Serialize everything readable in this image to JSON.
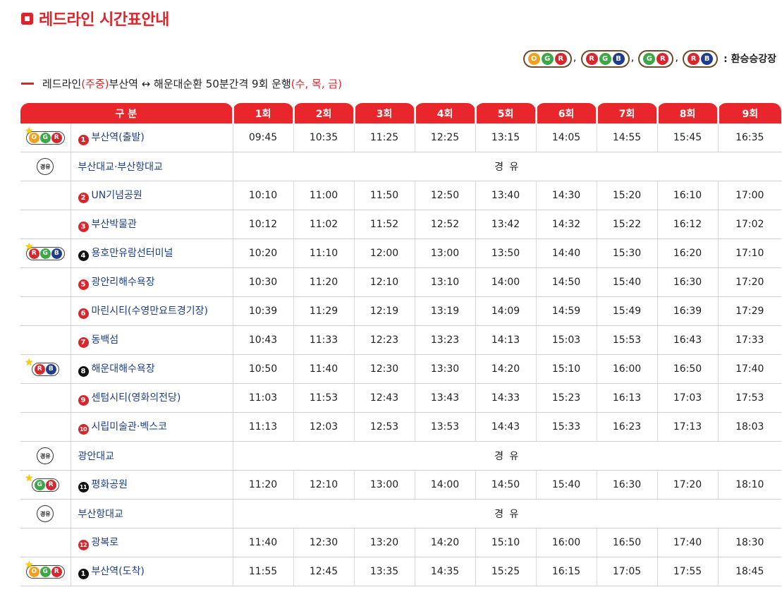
{
  "page": {
    "title": "레드라인 시간표안내"
  },
  "legend": {
    "badges": [
      [
        "O",
        "G",
        "R"
      ],
      [
        "R",
        "G",
        "B"
      ],
      [
        "G",
        "R"
      ],
      [
        "R",
        "B"
      ]
    ],
    "separator": ",",
    "description": ": 환승승강장"
  },
  "subtitle": {
    "prefix": "레드라인",
    "days_note": "(주중)",
    "route": " 부산역 ↔ 해운대순환 50분간격 9회 운행",
    "days": "(수, 목, 금)"
  },
  "table": {
    "header": {
      "section": "구 분",
      "runs": [
        "1회",
        "2회",
        "3회",
        "4회",
        "5회",
        "6회",
        "7회",
        "8회",
        "9회"
      ]
    },
    "via_label": "경 유",
    "via_icon_text": "경유",
    "rows": [
      {
        "mark": "badge",
        "lines": [
          "O",
          "G",
          "R"
        ],
        "num": "1",
        "num_style": "red",
        "name": "부산역(출발)",
        "times": [
          "09:45",
          "10:35",
          "11:25",
          "12:25",
          "13:15",
          "14:05",
          "14:55",
          "15:45",
          "16:35"
        ]
      },
      {
        "mark": "via",
        "name": "부산대교·부산항대교"
      },
      {
        "mark": "",
        "num": "2",
        "num_style": "red",
        "name": "UN기념공원",
        "times": [
          "10:10",
          "11:00",
          "11:50",
          "12:50",
          "13:40",
          "14:30",
          "15:20",
          "16:10",
          "17:00"
        ]
      },
      {
        "mark": "",
        "num": "3",
        "num_style": "red",
        "name": "부산박물관",
        "times": [
          "10:12",
          "11:02",
          "11:52",
          "12:52",
          "13:42",
          "14:32",
          "15:22",
          "16:12",
          "17:02"
        ]
      },
      {
        "mark": "badge",
        "lines": [
          "R",
          "G",
          "B"
        ],
        "num": "4",
        "num_style": "black",
        "name": "용호만유람선터미널",
        "times": [
          "10:20",
          "11:10",
          "12:00",
          "13:00",
          "13:50",
          "14:40",
          "15:30",
          "16:20",
          "17:10"
        ]
      },
      {
        "mark": "",
        "num": "5",
        "num_style": "red",
        "name": "광안리해수욕장",
        "times": [
          "10:30",
          "11:20",
          "12:10",
          "13:10",
          "14:00",
          "14:50",
          "15:40",
          "16:30",
          "17:20"
        ]
      },
      {
        "mark": "",
        "num": "6",
        "num_style": "red",
        "name": "마린시티(수영만요트경기장)",
        "times": [
          "10:39",
          "11:29",
          "12:19",
          "13:19",
          "14:09",
          "14:59",
          "15:49",
          "16:39",
          "17:29"
        ]
      },
      {
        "mark": "",
        "num": "7",
        "num_style": "red",
        "name": "동백섬",
        "times": [
          "10:43",
          "11:33",
          "12:23",
          "13:23",
          "14:13",
          "15:03",
          "15:53",
          "16:43",
          "17:33"
        ]
      },
      {
        "mark": "badge",
        "lines": [
          "R",
          "B"
        ],
        "num": "8",
        "num_style": "black",
        "name": "해운대해수욕장",
        "times": [
          "10:50",
          "11:40",
          "12:30",
          "13:30",
          "14:20",
          "15:10",
          "16:00",
          "16:50",
          "17:40"
        ]
      },
      {
        "mark": "",
        "num": "9",
        "num_style": "red",
        "name": "센텀시티(영화의전당)",
        "times": [
          "11:03",
          "11:53",
          "12:43",
          "13:43",
          "14:33",
          "15:23",
          "16:13",
          "17:03",
          "17:53"
        ]
      },
      {
        "mark": "",
        "num": "10",
        "num_style": "red",
        "name": "시립미술관·벡스코",
        "times": [
          "11:13",
          "12:03",
          "12:53",
          "13:53",
          "14:43",
          "15:33",
          "16:23",
          "17:13",
          "18:03"
        ]
      },
      {
        "mark": "via",
        "name": "광안대교"
      },
      {
        "mark": "badge",
        "lines": [
          "G",
          "R"
        ],
        "num": "11",
        "num_style": "black",
        "name": "평화공원",
        "times": [
          "11:20",
          "12:10",
          "13:00",
          "14:00",
          "14:50",
          "15:40",
          "16:30",
          "17:20",
          "18:10"
        ]
      },
      {
        "mark": "via",
        "name": "부산항대교"
      },
      {
        "mark": "",
        "num": "12",
        "num_style": "red",
        "name": "광복로",
        "times": [
          "11:40",
          "12:30",
          "13:20",
          "14:20",
          "15:10",
          "16:00",
          "16:50",
          "17:40",
          "18:30"
        ]
      },
      {
        "mark": "badge",
        "lines": [
          "O",
          "G",
          "R"
        ],
        "num": "1",
        "num_style": "black",
        "name": "부산역(도착)",
        "times": [
          "11:55",
          "12:45",
          "13:35",
          "14:35",
          "15:25",
          "16:15",
          "17:05",
          "17:55",
          "18:45"
        ]
      }
    ]
  },
  "colors": {
    "accent": "#e8262b",
    "link": "#1d3f8a",
    "line_o": "#f2a01b",
    "line_g": "#39a845",
    "line_r": "#d9262c",
    "line_b": "#1f3c8f"
  },
  "icons": {
    "star": "star-icon",
    "via": "via-icon"
  }
}
